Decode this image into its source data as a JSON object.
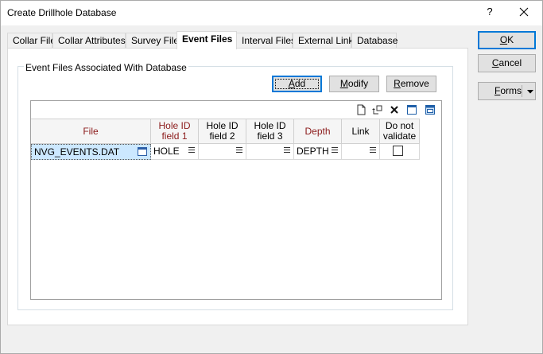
{
  "window": {
    "title": "Create Drillhole Database",
    "help_label": "?"
  },
  "tabs": [
    {
      "label": "Collar File",
      "active": false
    },
    {
      "label": "Collar Attributes",
      "active": false
    },
    {
      "label": "Survey File",
      "active": false
    },
    {
      "label": "Event Files",
      "active": true
    },
    {
      "label": "Interval Files",
      "active": false
    },
    {
      "label": "External Link",
      "active": false
    },
    {
      "label": "Database",
      "active": false
    }
  ],
  "group": {
    "label": "Event Files Associated With Database"
  },
  "actions": {
    "add": {
      "pre": "",
      "u": "A",
      "post": "dd"
    },
    "modify": {
      "pre": "",
      "u": "M",
      "post": "odify"
    },
    "remove": {
      "pre": "",
      "u": "R",
      "post": "emove"
    }
  },
  "side_buttons": {
    "ok": {
      "pre": "",
      "u": "O",
      "post": "K"
    },
    "cancel": {
      "pre": "",
      "u": "C",
      "post": "ancel"
    },
    "forms": {
      "pre": "",
      "u": "F",
      "post": "orms"
    }
  },
  "grid": {
    "toolbar_icons": [
      "new-row-icon",
      "insert-row-icon",
      "delete-row-icon",
      "restore-icon",
      "maximize-icon"
    ],
    "columns": [
      {
        "line1": "File",
        "line2": "",
        "required": true
      },
      {
        "line1": "Hole ID",
        "line2": "field 1",
        "required": true
      },
      {
        "line1": "Hole ID",
        "line2": "field 2",
        "required": false
      },
      {
        "line1": "Hole ID",
        "line2": "field 3",
        "required": false
      },
      {
        "line1": "Depth",
        "line2": "",
        "required": true
      },
      {
        "line1": "Link",
        "line2": "",
        "required": false
      },
      {
        "line1": "Do not",
        "line2": "validate",
        "required": false
      }
    ],
    "rows": [
      {
        "file": "NVG_EVENTS.DAT",
        "hole1": "HOLE",
        "hole2": "",
        "hole3": "",
        "depth": "DEPTH",
        "link": "",
        "no_validate": false
      }
    ]
  },
  "colors": {
    "required_header": "#8b1a1a",
    "selection": "#cce8ff",
    "accent": "#0078d7"
  }
}
